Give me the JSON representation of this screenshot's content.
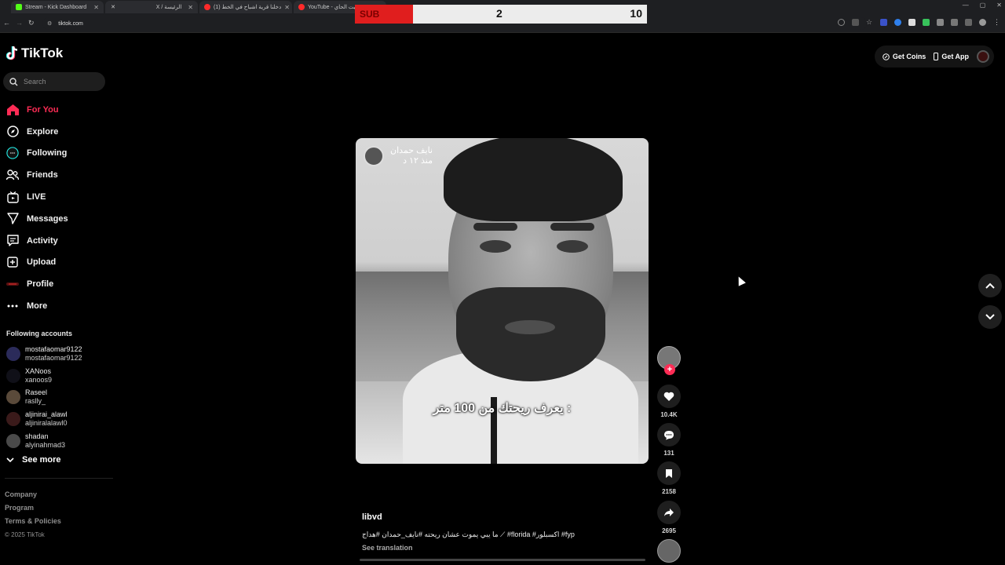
{
  "browser": {
    "tabs": [
      {
        "title": "Stream - Kick Dashboard",
        "color": "#53fc18"
      },
      {
        "title": "X / الرئيسة",
        "color": "#ffffff"
      },
      {
        "title": "(1) دخلنا قرية اشباح في الخط",
        "color": "#ff2a2a"
      },
      {
        "title": "YouTube - بيت الحاي",
        "color": "#ff2a2a"
      }
    ],
    "url": "tiktok.com"
  },
  "sub_counter": {
    "label": "SUB",
    "value_left": "2",
    "value_right": "10"
  },
  "sidebar": {
    "logo_text": "TikTok",
    "search_placeholder": "Search",
    "nav": [
      {
        "label": "For You",
        "icon": "home-icon",
        "active": true
      },
      {
        "label": "Explore",
        "icon": "compass-icon",
        "active": false
      },
      {
        "label": "Following",
        "icon": "following-icon",
        "active": false
      },
      {
        "label": "Friends",
        "icon": "friends-icon",
        "active": false
      },
      {
        "label": "LIVE",
        "icon": "live-icon",
        "active": false
      },
      {
        "label": "Messages",
        "icon": "messages-icon",
        "active": false
      },
      {
        "label": "Activity",
        "icon": "activity-icon",
        "active": false
      },
      {
        "label": "Upload",
        "icon": "upload-icon",
        "active": false
      },
      {
        "label": "Profile",
        "icon": "profile-icon",
        "active": false
      },
      {
        "label": "More",
        "icon": "more-icon",
        "active": false
      }
    ],
    "following_title": "Following accounts",
    "accounts": [
      {
        "name": "mostafaomar9122",
        "handle": "mostafaomar9122"
      },
      {
        "name": "XANoos",
        "handle": "xanoos9"
      },
      {
        "name": "Raseel",
        "handle": "raslly_"
      },
      {
        "name": "aljinirai_alawl",
        "handle": "aljiniralalawl0"
      },
      {
        "name": "shadan",
        "handle": "alyinahmad3"
      }
    ],
    "see_more": "See more",
    "footer": {
      "company": "Company",
      "program": "Program",
      "terms": "Terms & Policies",
      "copyright": "© 2025 TikTok"
    }
  },
  "header": {
    "get_coins": "Get Coins",
    "get_app": "Get App"
  },
  "video": {
    "overlay_name": "نايف حمدان",
    "overlay_time": "منذ ١٢ د",
    "caption": "يعرف ريحتك من 100 متر :"
  },
  "actions": {
    "likes": "10.4K",
    "comments": "131",
    "saves": "2158",
    "shares": "2695"
  },
  "post": {
    "author": "libvd",
    "description": "ما يبي يموت عشان ريحته #نايف_حمدان #هداج ⟋ #florida #اكسبلور #fyp",
    "see_translation": "See translation"
  },
  "colors": {
    "accent": "#fe2c55",
    "background": "#000000"
  }
}
